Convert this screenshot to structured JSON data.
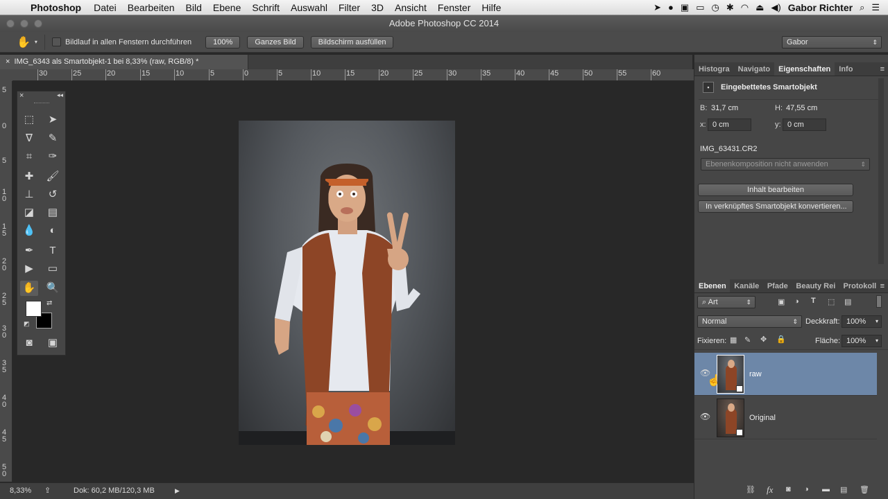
{
  "menubar": {
    "app": "Photoshop",
    "items": [
      "Datei",
      "Bearbeiten",
      "Bild",
      "Ebene",
      "Schrift",
      "Auswahl",
      "Filter",
      "3D",
      "Ansicht",
      "Fenster",
      "Hilfe"
    ],
    "user": "Gabor Richter"
  },
  "window": {
    "title": "Adobe Photoshop CC 2014"
  },
  "options": {
    "checkbox_label": "Bildlauf in allen Fenstern durchführen",
    "zoom_button": "100%",
    "fit_button": "Ganzes Bild",
    "fill_button": "Bildschirm ausfüllen",
    "workspace": "Gabor"
  },
  "document": {
    "tab_title": "IMG_6343 als Smartobjekt-1 bei 8,33% (raw, RGB/8) *",
    "h_ruler": [
      "30",
      "25",
      "20",
      "15",
      "10",
      "5",
      "0",
      "5",
      "10",
      "15",
      "20",
      "25",
      "30",
      "35",
      "40",
      "45",
      "50",
      "55",
      "60"
    ],
    "v_ruler": [
      "5",
      "0",
      "5",
      "1\n0",
      "1\n5",
      "2\n0",
      "2\n5",
      "3\n0",
      "3\n5",
      "4\n0",
      "4\n5",
      "5\n0"
    ]
  },
  "status": {
    "zoom": "8,33%",
    "doc": "Dok: 60,2 MB/120,3 MB"
  },
  "properties": {
    "tabs": [
      "Histogra",
      "Navigato",
      "Eigenschaften",
      "Info"
    ],
    "header": "Eingebettetes Smartobjekt",
    "w_label": "B:",
    "w_value": "31,7 cm",
    "h_label": "H:",
    "h_value": "47,55 cm",
    "x_label": "x:",
    "x_value": "0 cm",
    "y_label": "y:",
    "y_value": "0 cm",
    "filename": "IMG_63431.CR2",
    "comp_select": "Ebenenkomposition nicht anwenden",
    "edit_button": "Inhalt bearbeiten",
    "convert_button": "In verknüpftes Smartobjekt konvertieren..."
  },
  "layers_panel": {
    "tabs": [
      "Ebenen",
      "Kanäle",
      "Pfade",
      "Beauty Rei",
      "Protokoll"
    ],
    "filter": "Art",
    "blend_mode": "Normal",
    "opacity_label": "Deckkraft:",
    "opacity": "100%",
    "lock_label": "Fixieren:",
    "fill_label": "Fläche:",
    "fill": "100%",
    "layers": [
      {
        "name": "raw",
        "selected": true
      },
      {
        "name": "Original",
        "selected": false
      }
    ]
  },
  "colors": {
    "accent_selected_layer": "#6d87a8",
    "foreground": "#ffffff",
    "background": "#000000"
  }
}
